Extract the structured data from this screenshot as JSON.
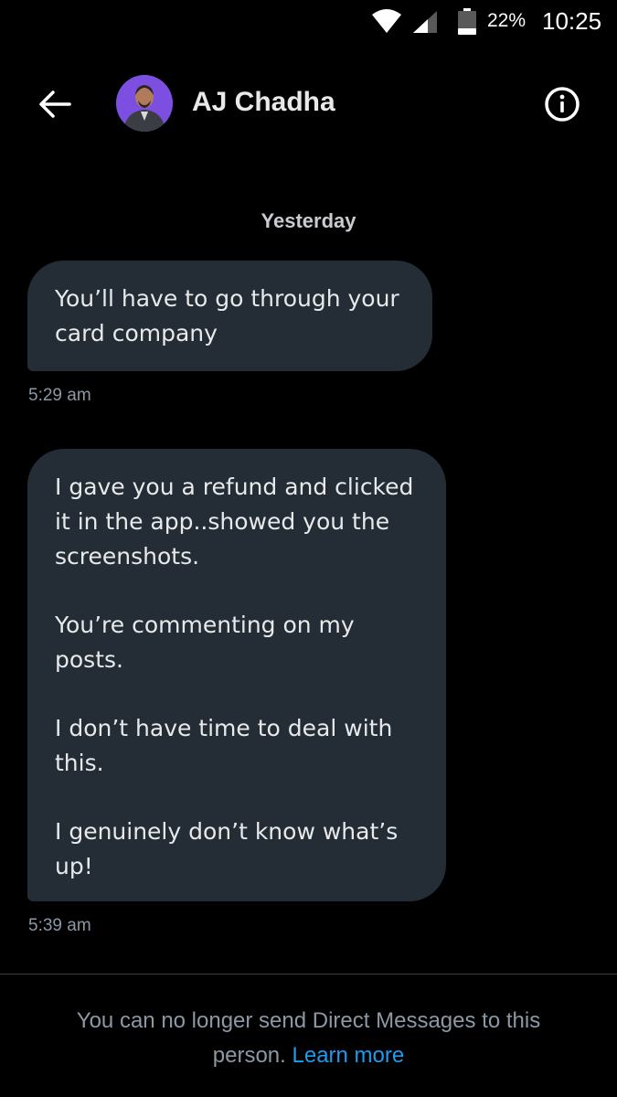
{
  "status_bar": {
    "battery_percent": "22%",
    "time": "10:25",
    "icons": [
      "wifi-icon",
      "signal-icon",
      "battery-icon"
    ]
  },
  "header": {
    "contact_name": "AJ Chadha",
    "icons": [
      "back-arrow-icon",
      "avatar",
      "info-icon"
    ],
    "avatar_bg": "#7c4fe0"
  },
  "conversation": {
    "date_divider": "Yesterday",
    "messages": [
      {
        "lines": [
          "You’ll have to go through your",
          "card company"
        ],
        "time": "5:29 am"
      },
      {
        "lines": [
          "I gave you a refund and clicked",
          "it in the app..showed you the",
          "screenshots.",
          "",
          "You’re commenting on my",
          "posts.",
          "",
          "I don’t have time to deal with",
          "this.",
          "",
          "I genuinely don’t know what’s",
          "up!"
        ],
        "time": "5:39 am"
      }
    ]
  },
  "footer": {
    "notice_line1": "You can no longer send Direct Messages to this",
    "notice_line2": "person.",
    "learn_more": "Learn more"
  },
  "colors": {
    "background": "#000000",
    "bubble": "#242d35",
    "link": "#1d9bf0",
    "muted": "#8b98a5"
  }
}
